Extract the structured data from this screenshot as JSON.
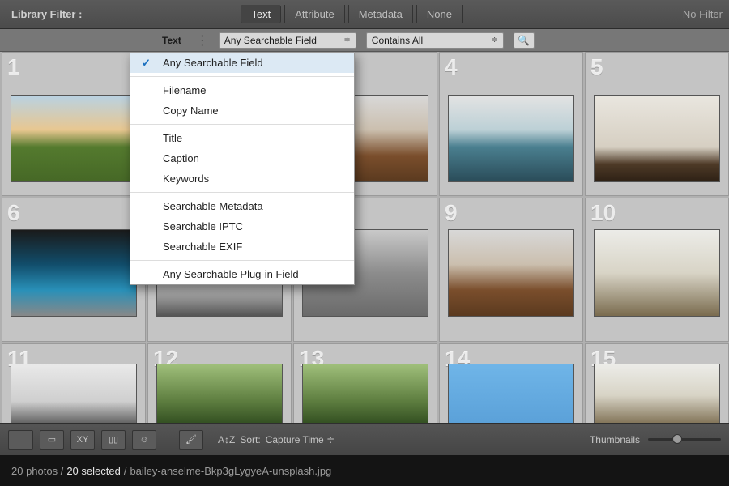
{
  "filterbar": {
    "title": "Library Filter :",
    "tabs": [
      {
        "label": "Text",
        "active": true
      },
      {
        "label": "Attribute",
        "active": false
      },
      {
        "label": "Metadata",
        "active": false
      },
      {
        "label": "None",
        "active": false
      }
    ],
    "nofilter_label": "No Filter"
  },
  "subbar": {
    "label": "Text",
    "separator": "⋮",
    "field_combo": "Any Searchable Field",
    "rule_combo": "Contains All",
    "search_icon": "🔍"
  },
  "dropdown": {
    "items": [
      {
        "label": "Any Searchable Field",
        "selected": true
      },
      {
        "sep": true
      },
      {
        "label": "Filename"
      },
      {
        "label": "Copy Name"
      },
      {
        "sep": true
      },
      {
        "label": "Title"
      },
      {
        "label": "Caption"
      },
      {
        "label": "Keywords"
      },
      {
        "sep": true
      },
      {
        "label": "Searchable Metadata"
      },
      {
        "label": "Searchable IPTC"
      },
      {
        "label": "Searchable EXIF"
      },
      {
        "sep": true
      },
      {
        "label": "Any Searchable Plug-in Field"
      }
    ]
  },
  "grid": {
    "cells": [
      {
        "n": "1"
      },
      {
        "n": ""
      },
      {
        "n": ""
      },
      {
        "n": "4"
      },
      {
        "n": "5"
      },
      {
        "n": "6"
      },
      {
        "n": ""
      },
      {
        "n": ""
      },
      {
        "n": "9"
      },
      {
        "n": "10"
      },
      {
        "n": "11"
      },
      {
        "n": "12"
      },
      {
        "n": "13"
      },
      {
        "n": "14"
      },
      {
        "n": "15"
      }
    ]
  },
  "bottombar": {
    "xy_label": "XY",
    "sort_prefix_icon": "A↕Z",
    "sort_label": "Sort:",
    "sort_value": "Capture Time",
    "sort_chevron": "≑",
    "thumbnails_label": "Thumbnails"
  },
  "status": {
    "count": "20 photos /",
    "selected": "20 selected ",
    "separator": "/",
    "filename": "bailey-anselme-Bkp3gLygyeA-unsplash.jpg"
  }
}
